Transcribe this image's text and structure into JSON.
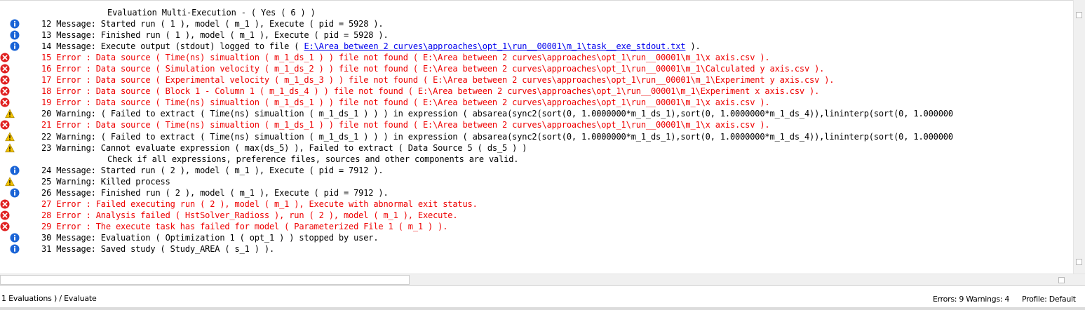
{
  "log": {
    "lines": [
      {
        "kind": "header",
        "icon": "none",
        "text": "Evaluation Multi-Execution - ( Yes ( 6 ) )"
      },
      {
        "kind": "message",
        "icon": "info-icon",
        "text": "12 Message: Started  run ( 1 ), model ( m_1 ), Execute ( pid = 5928 )."
      },
      {
        "kind": "message",
        "icon": "info-icon",
        "text": "13 Message: Finished run ( 1 ), model ( m_1 ), Execute ( pid = 5928 )."
      },
      {
        "kind": "message",
        "icon": "info-icon",
        "text": "14 Message: Execute output (stdout) logged to file ( ",
        "link": "E:\\Area between 2 curves\\approaches\\opt_1\\run__00001\\m_1\\task__exe_stdout.txt",
        "suffix": " )."
      },
      {
        "kind": "error",
        "icon": "error-icon",
        "text": "15 Error  : Data source ( Time(ns) simualtion ( m_1_ds_1 ) ) file not found ( E:\\Area between 2 curves\\approaches\\opt_1\\run__00001\\m_1\\x axis.csv )."
      },
      {
        "kind": "error",
        "icon": "error-icon",
        "text": "16 Error  : Data source ( Simulation velocity  ( m_1_ds_2 ) ) file not found ( E:\\Area between 2 curves\\approaches\\opt_1\\run__00001\\m_1\\Calculated y axis.csv )."
      },
      {
        "kind": "error",
        "icon": "error-icon",
        "text": "17 Error  : Data source ( Experimental velocity ( m_1_ds_3 ) ) file not found ( E:\\Area between 2 curves\\approaches\\opt_1\\run__00001\\m_1\\Experiment y axis.csv )."
      },
      {
        "kind": "error",
        "icon": "error-icon",
        "text": "18 Error  : Data source ( Block 1 - Column 1 ( m_1_ds_4 ) ) file not found ( E:\\Area between 2 curves\\approaches\\opt_1\\run__00001\\m_1\\Experiment x axis.csv )."
      },
      {
        "kind": "error",
        "icon": "error-icon",
        "text": "19 Error  : Data source ( Time(ns) simualtion ( m_1_ds_1 ) ) file not found ( E:\\Area between 2 curves\\approaches\\opt_1\\run__00001\\m_1\\x axis.csv )."
      },
      {
        "kind": "warning",
        "icon": "warning-icon",
        "text": "20 Warning: ( Failed to extract ( Time(ns) simualtion ( m_1_ds_1 ) ) ) in expression ( absarea(sync2(sort(0, 1.0000000*m_1_ds_1),sort(0, 1.0000000*m_1_ds_4)),lininterp(sort(0, 1.000000"
      },
      {
        "kind": "error",
        "icon": "error-icon",
        "text": "21 Error  : Data source ( Time(ns) simualtion ( m_1_ds_1 ) ) file not found ( E:\\Area between 2 curves\\approaches\\opt_1\\run__00001\\m_1\\x axis.csv )."
      },
      {
        "kind": "warning",
        "icon": "warning-icon",
        "text": "22 Warning: ( Failed to extract ( Time(ns) simualtion ( m_1_ds_1 ) ) ) in expression ( absarea(sync2(sort(0, 1.0000000*m_1_ds_1),sort(0, 1.0000000*m_1_ds_4)),lininterp(sort(0, 1.000000"
      },
      {
        "kind": "warning",
        "icon": "warning-icon",
        "text": "23 Warning: Cannot evaluate expression ( max(ds_5) ), Failed to extract ( Data Source 5 ( ds_5 ) )"
      },
      {
        "kind": "continuation",
        "icon": "none",
        "text": "Check if all expressions, preference files, sources and other components are valid."
      },
      {
        "kind": "message",
        "icon": "info-icon",
        "text": "24 Message: Started  run ( 2 ), model ( m_1 ), Execute ( pid = 7912 )."
      },
      {
        "kind": "warning",
        "icon": "warning-icon",
        "text": "25 Warning: Killed process"
      },
      {
        "kind": "message",
        "icon": "info-icon",
        "text": "26 Message: Finished run ( 2 ), model ( m_1 ), Execute ( pid = 7912 )."
      },
      {
        "kind": "error",
        "icon": "error-icon",
        "text": "27 Error  : Failed executing run ( 2 ), model ( m_1 ), Execute with abnormal exit status."
      },
      {
        "kind": "error",
        "icon": "error-icon",
        "text": "28 Error  : Analysis failed ( HstSolver_Radioss ), run ( 2 ), model ( m_1 ), Execute."
      },
      {
        "kind": "error",
        "icon": "error-icon",
        "text": "29 Error  : The execute task has failed for model ( Parameterized File 1 ( m_1 ) )."
      },
      {
        "kind": "message",
        "icon": "info-icon",
        "text": "30 Message: Evaluation ( Optimization 1 ( opt_1 ) ) stopped by user."
      },
      {
        "kind": "message",
        "icon": "info-icon",
        "text": "31 Message: Saved study ( Study_AREA ( s_1 ) )."
      }
    ]
  },
  "status_bar": {
    "left_text": "1 Evaluations ) / Evaluate",
    "counts_text": "Errors: 9  Warnings: 4",
    "profile_text": "Profile: Default"
  },
  "colors": {
    "error_text": "#ee0000",
    "info_icon": "#1a64d6",
    "error_icon": "#e02020",
    "warning_icon": "#f2c200",
    "link": "#0000ee"
  }
}
